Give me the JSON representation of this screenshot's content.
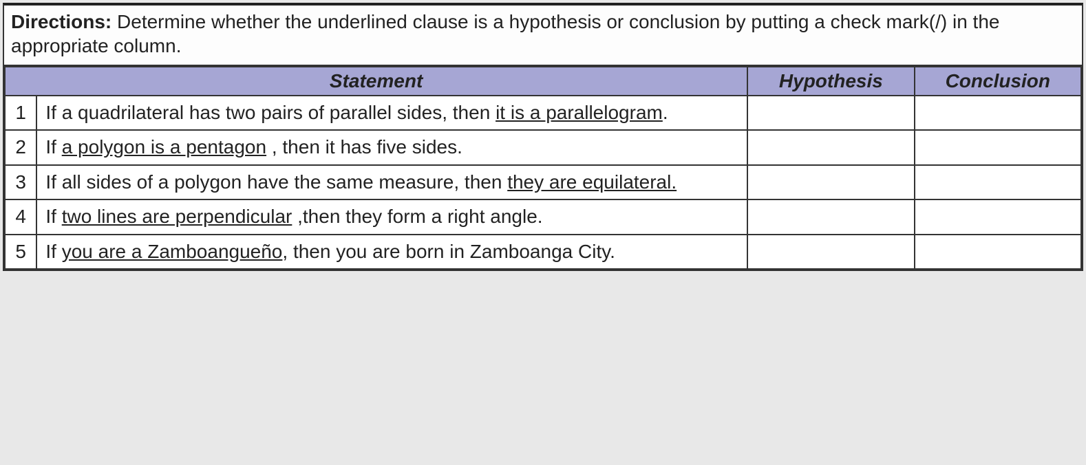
{
  "directions": {
    "label": "Directions:",
    "text_part1": " Determine whether the underlined clause is a hypothesis or conclusion by putting a check mark(/) in the appropriate column."
  },
  "headers": {
    "statement": "Statement",
    "hypothesis": "Hypothesis",
    "conclusion": "Conclusion"
  },
  "rows": [
    {
      "num": "1",
      "pre": "If a quadrilateral has two pairs of parallel sides, then ",
      "underlined": "it is a parallelogram",
      "post": ".",
      "hypothesis": "",
      "conclusion": ""
    },
    {
      "num": "2",
      "pre": "If ",
      "underlined": "a polygon is a pentagon",
      "post": " , then it has five sides.",
      "hypothesis": "",
      "conclusion": ""
    },
    {
      "num": "3",
      "pre": "If all sides of a polygon have the same measure, then ",
      "underlined": "they are equilateral.",
      "post": "",
      "hypothesis": "",
      "conclusion": ""
    },
    {
      "num": "4",
      "pre": "If ",
      "underlined": "two lines are perpendicular",
      "post": " ,then they form a right angle.",
      "hypothesis": "",
      "conclusion": ""
    },
    {
      "num": "5",
      "pre": "If ",
      "underlined": "you are a Zamboangueño",
      "post": ", then you are born in Zamboanga City.",
      "hypothesis": "",
      "conclusion": ""
    }
  ]
}
